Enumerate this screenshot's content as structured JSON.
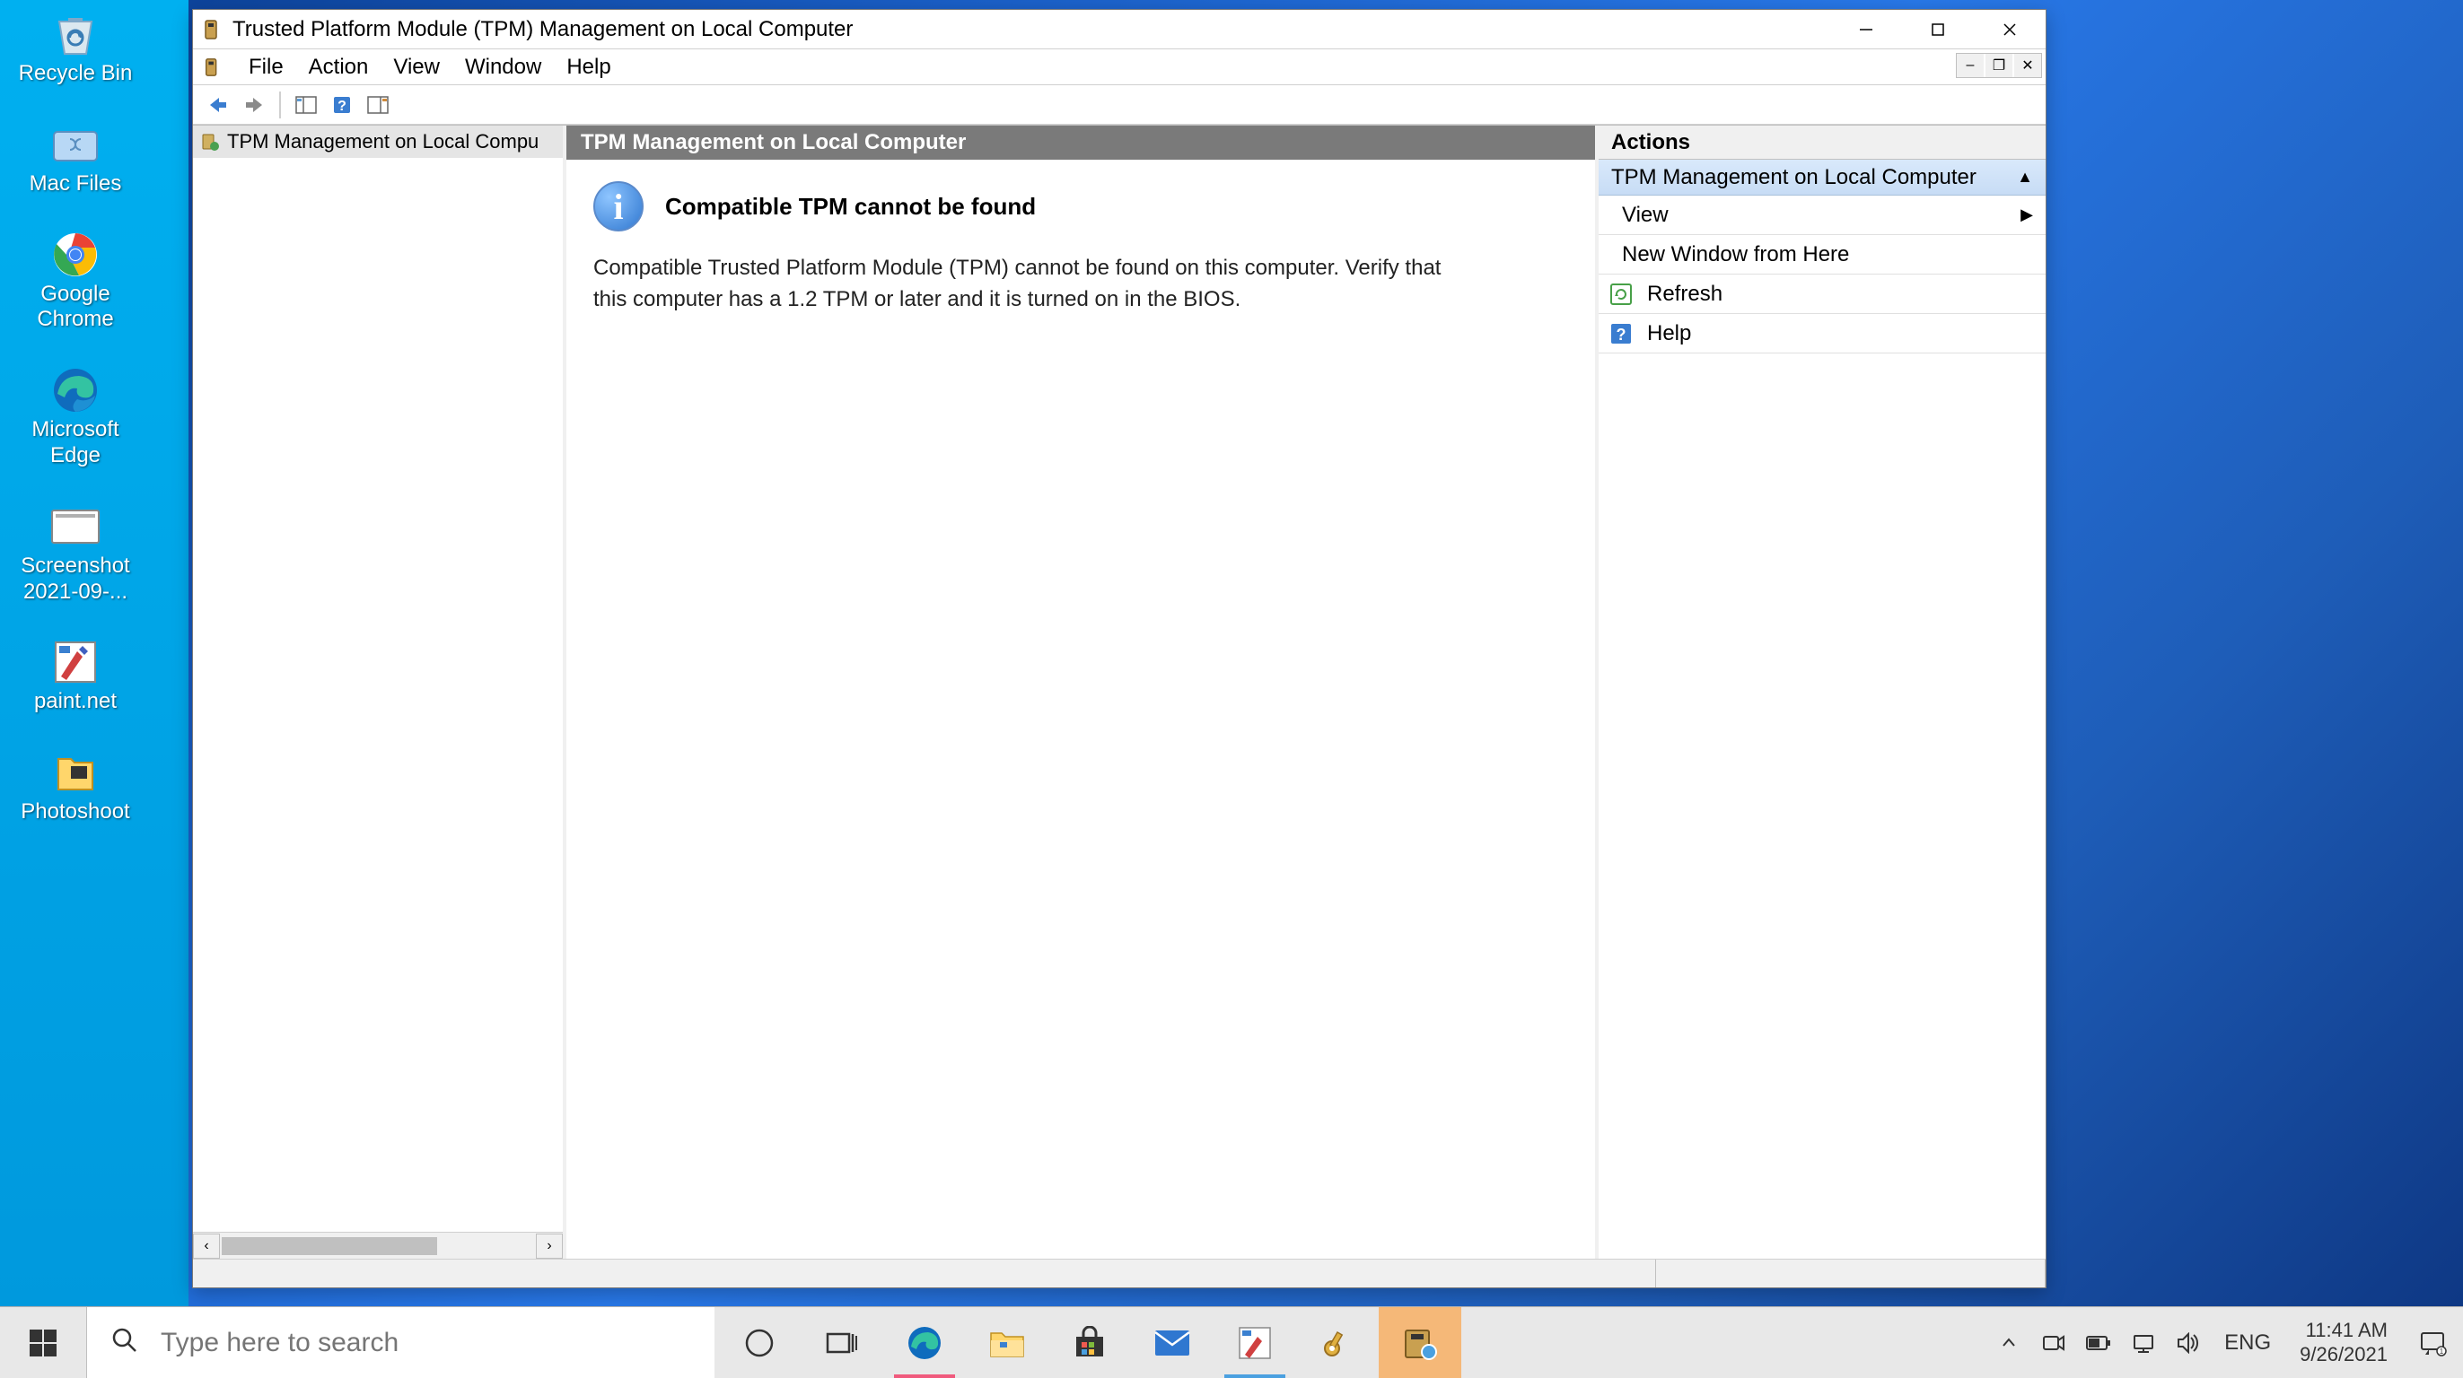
{
  "desktop_icons": [
    {
      "label": "Recycle Bin",
      "name": "recycle-bin"
    },
    {
      "label": "Mac Files",
      "name": "mac-files"
    },
    {
      "label": "Google Chrome",
      "name": "google-chrome"
    },
    {
      "label": "Microsoft Edge",
      "name": "microsoft-edge"
    },
    {
      "label": "Screenshot 2021-09-...",
      "name": "screenshot"
    },
    {
      "label": "paint.net",
      "name": "paint-net"
    },
    {
      "label": "Photoshoot",
      "name": "photoshoot"
    }
  ],
  "window": {
    "title": "Trusted Platform Module (TPM) Management on Local Computer",
    "menubar": [
      "File",
      "Action",
      "View",
      "Window",
      "Help"
    ],
    "tree_item": "TPM Management on Local Compu",
    "content_header": "TPM Management on Local Computer",
    "info_title": "Compatible TPM cannot be found",
    "info_text": "Compatible Trusted Platform Module (TPM) cannot be found on this computer. Verify that this computer has a 1.2 TPM or later and it is turned on in the BIOS.",
    "actions_header": "Actions",
    "actions_group": "TPM Management on Local Computer",
    "actions_items": {
      "view": "View",
      "new_window": "New Window from Here",
      "refresh": "Refresh",
      "help": "Help"
    }
  },
  "taskbar": {
    "search_placeholder": "Type here to search",
    "lang": "ENG",
    "time": "11:41 AM",
    "date": "9/26/2021"
  }
}
